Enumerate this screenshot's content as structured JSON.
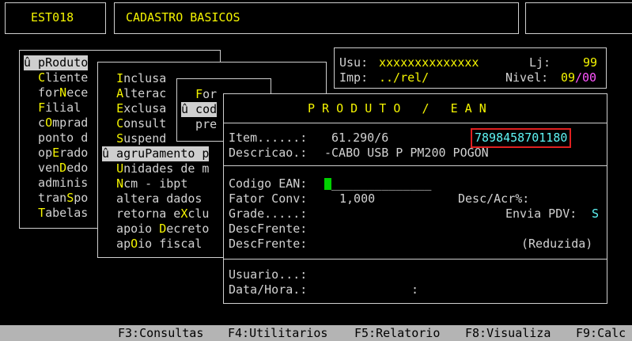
{
  "header": {
    "program_code": "EST018",
    "screen_title": "CADASTRO BASICOS"
  },
  "session": {
    "user_label": "Usu:",
    "user_value": "xxxxxxxxxxxxxx",
    "store_label": "Lj:",
    "store_value": "99",
    "printer_label": "Imp:",
    "printer_value": "../rel/",
    "level_label": "Nivel:",
    "level_value_a": "09",
    "level_sep": "/",
    "level_value_b": "00"
  },
  "menu_main": {
    "items": [
      {
        "pre": "û p",
        "hot": "",
        "post": "Roduto",
        "selected": true
      },
      {
        "pre": "  ",
        "hot": "C",
        "post": "liente",
        "selected": false
      },
      {
        "pre": "  for",
        "hot": "N",
        "post": "ece",
        "selected": false
      },
      {
        "pre": "  ",
        "hot": "F",
        "post": "ilial",
        "selected": false
      },
      {
        "pre": "  c",
        "hot": "O",
        "post": "mprad",
        "selected": false
      },
      {
        "pre": "  ponto d",
        "hot": "",
        "post": "",
        "selected": false
      },
      {
        "pre": "  op",
        "hot": "E",
        "post": "rado",
        "selected": false
      },
      {
        "pre": "  ven",
        "hot": "D",
        "post": "edo",
        "selected": false
      },
      {
        "pre": "  adminis",
        "hot": "",
        "post": "",
        "selected": false
      },
      {
        "pre": "  tran",
        "hot": "S",
        "post": "po",
        "selected": false
      },
      {
        "pre": "  ",
        "hot": "T",
        "post": "abelas",
        "selected": false
      }
    ]
  },
  "menu_product": {
    "items": [
      {
        "pre": "  ",
        "hot": "I",
        "post": "nclusa",
        "selected": false
      },
      {
        "pre": "  ",
        "hot": "A",
        "post": "lterac",
        "selected": false
      },
      {
        "pre": "  ",
        "hot": "E",
        "post": "xclusa",
        "selected": false
      },
      {
        "pre": "  ",
        "hot": "C",
        "post": "onsult",
        "selected": false
      },
      {
        "pre": "  ",
        "hot": "S",
        "post": "uspend",
        "selected": false
      },
      {
        "pre": "û agru",
        "hot": "P",
        "post": "amento p",
        "selected": true
      },
      {
        "pre": "  ",
        "hot": "U",
        "post": "nidades de m",
        "selected": false
      },
      {
        "pre": "  ",
        "hot": "N",
        "post": "cm - ibpt",
        "selected": false
      },
      {
        "pre": "  altera dados",
        "hot": "",
        "post": "",
        "selected": false
      },
      {
        "pre": "  retorna e",
        "hot": "X",
        "post": "clu",
        "selected": false
      },
      {
        "pre": "  apoio ",
        "hot": "D",
        "post": "ecreto",
        "selected": false
      },
      {
        "pre": "  ap",
        "hot": "O",
        "post": "io fiscal",
        "selected": false
      }
    ]
  },
  "menu_sub": {
    "items": [
      {
        "pre": "  ",
        "hot": "F",
        "post": "or",
        "selected": false
      },
      {
        "pre": "û cod",
        "hot": "",
        "post": "",
        "selected": true
      },
      {
        "pre": "  pre",
        "hot": "",
        "post": "",
        "selected": false
      }
    ]
  },
  "form": {
    "title": "P R O D U T O   /   E A N",
    "item_label": "Item......:",
    "item_value": "61.290/6",
    "item_ean": "7898458701180",
    "desc_label": "Descricao.:",
    "desc_value": "-CABO USB P PM200 POGON",
    "ean_label": "Codigo EAN:",
    "ean_placeholder": "______________",
    "fator_label": "Fator Conv:",
    "fator_value": "1,000",
    "descacr_label": "Desc/Acr%:",
    "grade_label": "Grade.....:",
    "envia_label": "Envia PDV:",
    "envia_value": "S",
    "descfrente1_label": "DescFrente:",
    "descfrente2_label": "DescFrente:",
    "reduzida_label": "(Reduzida)",
    "usuario_label": "Usuario...:",
    "datahora_label": "Data/Hora.:",
    "datahora_sep": ":"
  },
  "function_keys": [
    {
      "key": "F3",
      "label": "F3:Consultas"
    },
    {
      "key": "F4",
      "label": "F4:Utilitarios"
    },
    {
      "key": "F5",
      "label": "F5:Relatorio"
    },
    {
      "key": "F8",
      "label": "F8:Visualiza"
    },
    {
      "key": "F9",
      "label": "F9:Calc"
    }
  ],
  "colors": {
    "background": "#000000",
    "text": "#d2d2d2",
    "accent_yellow": "#f5f500",
    "highlight": "#cfcfcf",
    "ean_cyan": "#5ff5f5",
    "ean_box_red": "#e02020",
    "cursor_green": "#00d000",
    "level_pink": "#ff55ff"
  }
}
